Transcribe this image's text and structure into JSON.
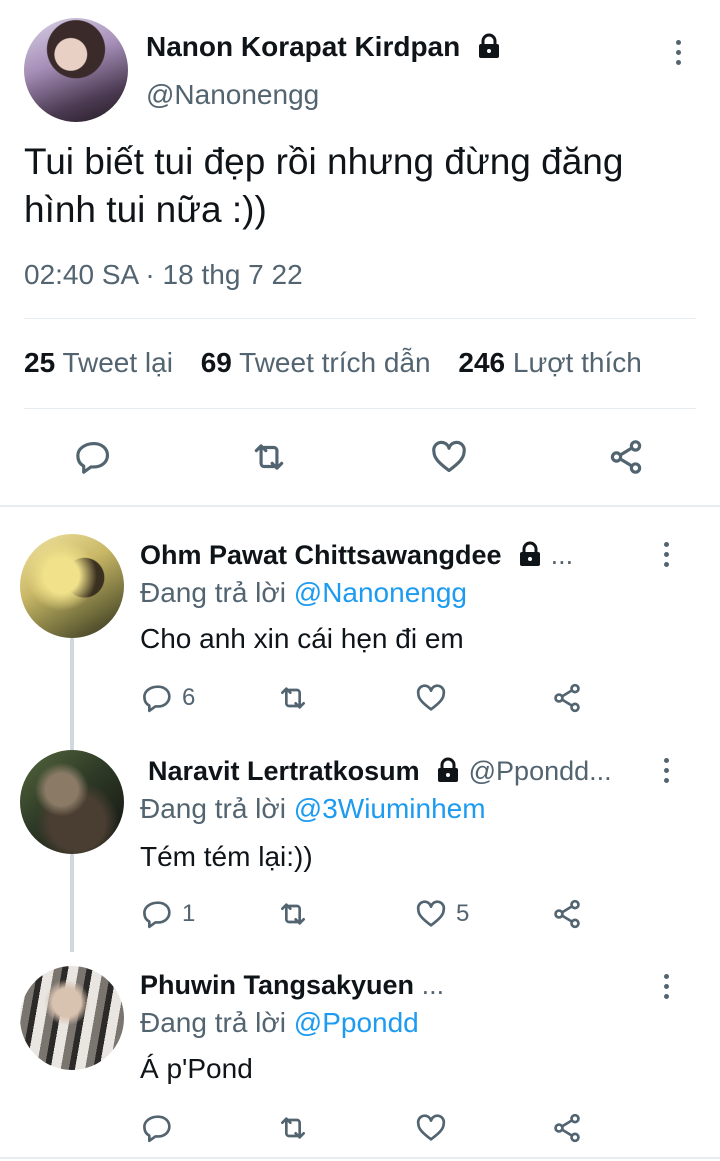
{
  "main_tweet": {
    "display_name": "Nanon Korapat Kirdpan",
    "handle": "@Nanonengg",
    "text_line1": "Tui biết tui đẹp rồi nhưng đừng đăng",
    "text_line2": "hình tui nữa :))",
    "timestamp": "02:40 SA · 18 thg 7 22",
    "stats": {
      "retweets_count": "25",
      "retweets_label": "Tweet lại",
      "quotes_count": "69",
      "quotes_label": "Tweet trích dẫn",
      "likes_count": "246",
      "likes_label": "Lượt thích"
    }
  },
  "replies": [
    {
      "display_name": "Ohm Pawat Chittsawangdee",
      "handle": "...",
      "replying_prefix": "Đang trả lời",
      "replying_to": "@Nanonengg",
      "text": "Cho anh xin cái hẹn đi em",
      "reply_count": "6",
      "like_count": ""
    },
    {
      "display_name": "Naravit Lertratkosum",
      "handle": "@Ppondd...",
      "replying_prefix": "Đang trả lời",
      "replying_to": "@3Wiuminhem",
      "text": "Tém tém lại:))",
      "reply_count": "1",
      "like_count": "5"
    },
    {
      "display_name": "Phuwin Tangsakyuen",
      "handle": "...",
      "replying_prefix": "Đang trả lời",
      "replying_to": "@Ppondd",
      "text": "Á p'Pond",
      "reply_count": "",
      "like_count": ""
    }
  ],
  "icons": {
    "reply": "reply-icon",
    "retweet": "retweet-icon",
    "like": "heart-icon",
    "share": "share-icon",
    "lock": "lock-icon",
    "more": "more-icon"
  },
  "colors": {
    "text": "#0f1419",
    "muted": "#536471",
    "link": "#1d9bf0",
    "divider": "#e6ecf0",
    "thread_line": "#cfd9de"
  }
}
